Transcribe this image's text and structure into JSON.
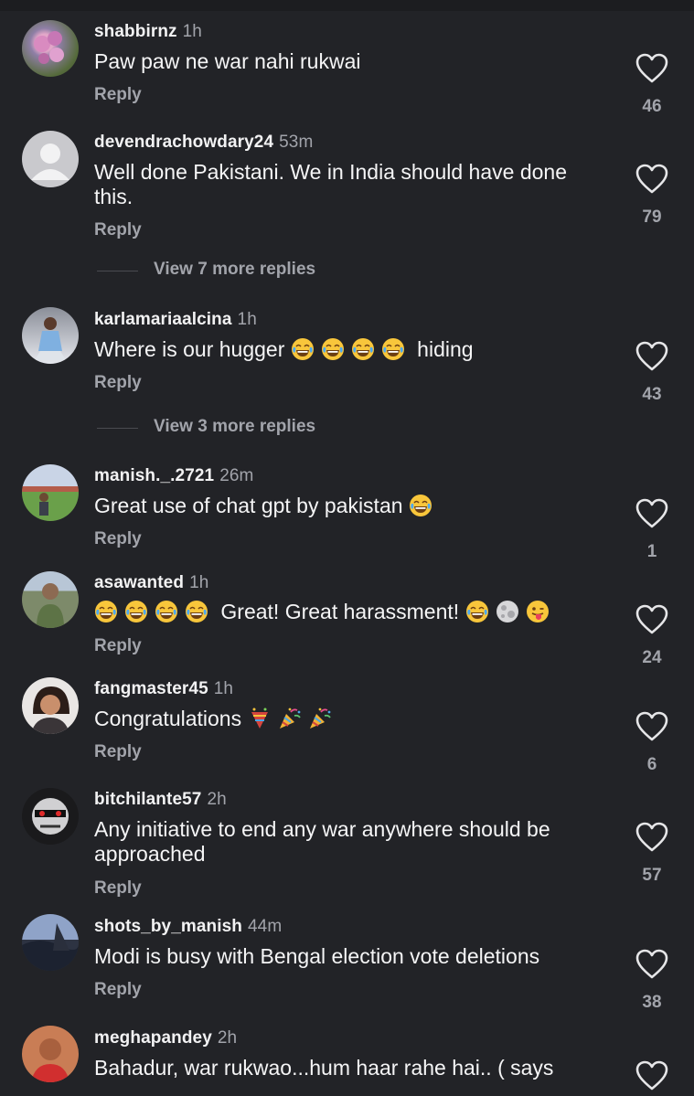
{
  "comments": [
    {
      "username": "shabbirnz",
      "time": "1h",
      "text": "Paw paw ne war nahi rukwai",
      "reply": "Reply",
      "likes": "46",
      "avatar": "flower"
    },
    {
      "username": "devendrachowdary24",
      "time": "53m",
      "text": "Well done Pakistani. We in India should have done this.",
      "reply": "Reply",
      "likes": "79",
      "avatar": "default",
      "more": "View 7 more replies"
    },
    {
      "username": "karlamariaalcina",
      "time": "1h",
      "text_before": "Where is our hugger",
      "emoji_count": 4,
      "text_after": "hiding",
      "reply": "Reply",
      "likes": "43",
      "avatar": "woman",
      "more": "View 3 more replies"
    },
    {
      "username": "manish._.2721",
      "time": "26m",
      "text": "Great use of chat gpt by pakistan",
      "reply": "Reply",
      "likes": "1",
      "avatar": "field"
    },
    {
      "username": "asawanted",
      "time": "1h",
      "text": "Great! Great harassment!",
      "reply": "Reply",
      "likes": "24",
      "avatar": "man"
    },
    {
      "username": "fangmaster45",
      "time": "1h",
      "text": "Congratulations",
      "reply": "Reply",
      "likes": "6",
      "avatar": "girl"
    },
    {
      "username": "bitchilante57",
      "time": "2h",
      "text": "Any initiative to end any war anywhere should be approached",
      "reply": "Reply",
      "likes": "57",
      "avatar": "dark"
    },
    {
      "username": "shots_by_manish",
      "time": "44m",
      "text": "Modi is busy with Bengal election vote deletions",
      "reply": "Reply",
      "likes": "38",
      "avatar": "sea"
    },
    {
      "username": "meghapandey",
      "time": "2h",
      "text": "Bahadur, war rukwao...hum haar rahe hai.. ( says",
      "reply": "",
      "likes": "",
      "avatar": "red"
    }
  ],
  "icons": {
    "like": "heart-outline-icon",
    "emoji_laugh": "face-with-tears-of-joy",
    "emoji_moon": "full-moon-face",
    "emoji_tongue": "face-with-tongue",
    "emoji_confetti": "confetti-ball",
    "emoji_party": "party-popper"
  },
  "colors": {
    "background": "#222327",
    "secondary_text": "#a2a4ab"
  }
}
